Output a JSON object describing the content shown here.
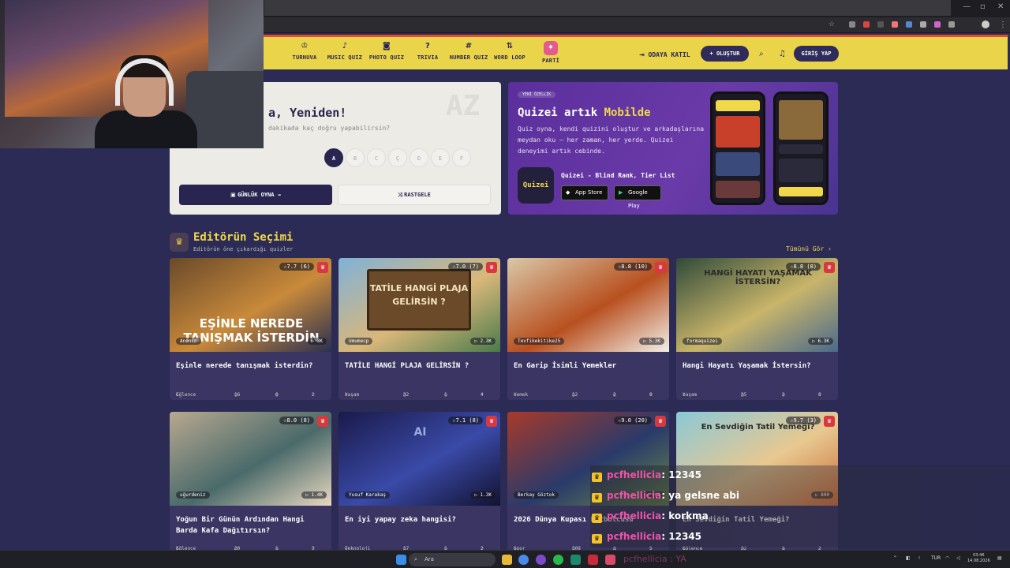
{
  "nav": {
    "items": [
      {
        "label": "TURNUVA",
        "icon": "trophy-icon",
        "glyph": "♔"
      },
      {
        "label": "MUSIC QUIZ",
        "icon": "music-icon",
        "glyph": "♪"
      },
      {
        "label": "PHOTO QUIZ",
        "icon": "camera-icon",
        "glyph": "◙"
      },
      {
        "label": "TRIVIA",
        "icon": "question-icon",
        "glyph": "?"
      },
      {
        "label": "NUMBER QUIZ",
        "icon": "hash-icon",
        "glyph": "#"
      },
      {
        "label": "WORD LOOP",
        "icon": "shuffle-icon",
        "glyph": "⇅"
      },
      {
        "label": "PARTİ",
        "icon": "party-icon",
        "glyph": "✦"
      }
    ],
    "join_room": "ODAYA KATIL",
    "create": "+ OLUŞTUR",
    "login": "GİRİŞ YAP"
  },
  "daily": {
    "title": "a, Yeniden!",
    "subtitle": "dakikada kaç doğru yapabilirsin?",
    "watermark": "AZ",
    "letters": [
      "A",
      "B",
      "C",
      "Ç",
      "D",
      "E",
      "F"
    ],
    "play_button": "GÜNLÜK OYNA →",
    "random_button": "RASTGELE"
  },
  "mobile": {
    "badge": "YENİ ÖZELLİK",
    "title_prefix": "Quizei artık ",
    "title_highlight": "Mobilde",
    "text": "Quiz oyna, kendi quizini oluştur ve arkadaşlarına meydan oku — her zaman, her yerde. Quizei deneyimi artık cebinde.",
    "app_icon_text": "Quizei",
    "app_name": "Quizei - Blind Rank, Tier List",
    "app_store": "App Store",
    "google_play": "Google Play"
  },
  "section": {
    "title": "Editörün Seçimi",
    "subtitle": "Editörün öne çıkardığı quizler",
    "see_all": "Tümünü Gör ›"
  },
  "cards": [
    {
      "title": "Eşinle nerede tanışmak isterdin?",
      "rating": "☆7.7 (6)",
      "author": "Anonim",
      "views": "▷ 3K",
      "category": "Eğlence",
      "questions": "16",
      "comments": "0",
      "likes": "2",
      "overlay": "EŞİNLE NEREDE TANIŞMAK İSTERDİN",
      "colors": [
        "#6a4a2a",
        "#c98a3a",
        "#2a3050"
      ]
    },
    {
      "title": "TATİLE HANGİ PLAJA GELİRSİN ?",
      "rating": "☆7.0 (7)",
      "author": "Umumecp",
      "views": "▷ 2.3K",
      "category": "Yaşam",
      "questions": "32",
      "comments": "1",
      "likes": "4",
      "overlay": "TATİLE HANGİ PLAJA GELİRSİN ?",
      "colors": [
        "#7fb2d8",
        "#d9b77a",
        "#4a7a4a"
      ]
    },
    {
      "title": "En Garip İsimli Yemekler",
      "rating": "☆8.8 (10)",
      "author": "Tevfikekitike25",
      "views": "▷ 5.3K",
      "category": "Yemek",
      "questions": "12",
      "comments": "2",
      "likes": "8",
      "overlay": "",
      "colors": [
        "#d9c8a8",
        "#b8501f",
        "#f2efe8"
      ]
    },
    {
      "title": "Hangi Hayatı Yaşamak İstersin?",
      "rating": "☆8.8 (8)",
      "author": "formaquizei",
      "views": "▷ 6.3K",
      "category": "Yaşam",
      "questions": "35",
      "comments": "2",
      "likes": "8",
      "overlay": "HANGİ HAYATI YAŞAMAK İSTERSİN?",
      "colors": [
        "#2f4a3a",
        "#c9b56a",
        "#4a6a8a"
      ]
    },
    {
      "title": "Yoğun Bir Günün Ardından Hangi Barda Kafa Dağıtırsın?",
      "rating": "☆8.0 (8)",
      "author": "uğurdeniz",
      "views": "▷ 1.4K",
      "category": "Eğlence",
      "questions": "20",
      "comments": "1",
      "likes": "3",
      "overlay": "",
      "colors": [
        "#b8a890",
        "#4a6a6a",
        "#e8d8c0"
      ]
    },
    {
      "title": "En iyi yapay zeka hangisi?",
      "rating": "☆7.1 (8)",
      "author": "Yusuf Karakaş",
      "views": "▷ 1.3K",
      "category": "Teknoloji",
      "questions": "17",
      "comments": "1",
      "likes": "2",
      "overlay": "AI",
      "colors": [
        "#1a1a4a",
        "#3a4aa8",
        "#121230"
      ]
    },
    {
      "title": "2026 Dünya Kupası Futbolcusu",
      "rating": "☆9.0 (20)",
      "author": "Berkay Göztok",
      "views": "▷ 900",
      "category": "Spor",
      "questions": "108",
      "comments": "3",
      "likes": "5",
      "overlay": "",
      "colors": [
        "#a83a2a",
        "#2a3a6a",
        "#6a8a4a"
      ]
    },
    {
      "title": "En Sevdiğin Tatil Yemeği?",
      "rating": "☆9.7 (3)",
      "author": "",
      "views": "▷ 800",
      "category": "Eğlence",
      "questions": "32",
      "comments": "1",
      "likes": "2",
      "overlay": "En Sevdiğin Tatil Yemeği?",
      "colors": [
        "#8ac8d8",
        "#e8c890",
        "#c86a3a"
      ]
    }
  ],
  "chat": [
    {
      "user": "pcfhellicia",
      "message": ": 12345"
    },
    {
      "user": "pcfhellicia",
      "message": ": ya gelsne abi"
    },
    {
      "user": "pcfhellicia",
      "message": ": korkma"
    },
    {
      "user": "pcfhellicia",
      "message": ": 12345"
    }
  ],
  "taskbar": {
    "search_placeholder": "Ara",
    "faded_chat": "pcfhellicia : YA",
    "lang": "TUR",
    "time": "03:46",
    "date": "14.08.2026"
  }
}
